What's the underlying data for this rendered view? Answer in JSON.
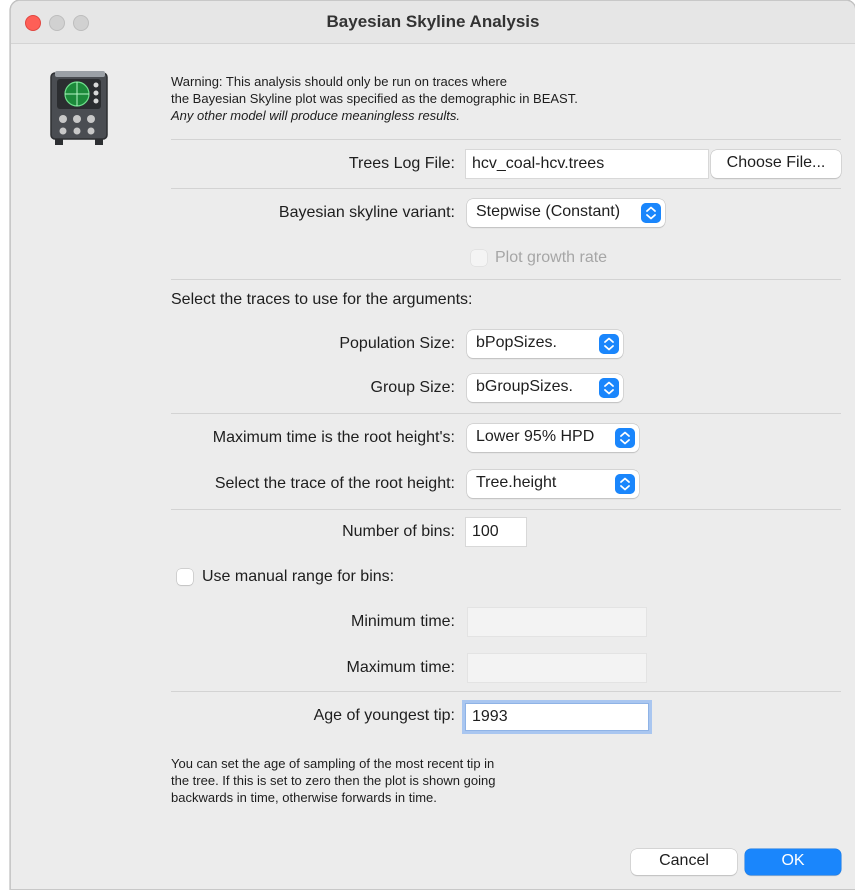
{
  "window": {
    "title": "Bayesian Skyline Analysis"
  },
  "warning": {
    "line1": "Warning: This analysis should only be run on traces where",
    "line2": "the Bayesian Skyline plot was specified as the demographic in BEAST.",
    "line3": "Any other model will produce meaningless results."
  },
  "trees_log": {
    "label": "Trees Log File:",
    "value": "hcv_coal-hcv.trees",
    "choose_button": "Choose File..."
  },
  "variant": {
    "label": "Bayesian skyline variant:",
    "value": "Stepwise (Constant)"
  },
  "growth_rate": {
    "label": "Plot growth rate",
    "checked": false,
    "enabled": false
  },
  "traces_heading": "Select the traces to use for the arguments:",
  "population_size": {
    "label": "Population Size:",
    "value": "bPopSizes."
  },
  "group_size": {
    "label": "Group Size:",
    "value": "bGroupSizes."
  },
  "max_time": {
    "label": "Maximum time is the root height's:",
    "value": "Lower 95% HPD"
  },
  "root_height": {
    "label": "Select the trace of the root height:",
    "value": "Tree.height"
  },
  "bins": {
    "label": "Number of bins:",
    "value": "100"
  },
  "manual_range": {
    "label": "Use manual range for bins:",
    "checked": false
  },
  "min_time": {
    "label": "Minimum time:",
    "value": ""
  },
  "max_time_field": {
    "label": "Maximum time:",
    "value": ""
  },
  "youngest_tip": {
    "label": "Age of youngest tip:",
    "value": "1993"
  },
  "note": {
    "line1": "You can set the age of sampling of the most recent tip in",
    "line2": "the tree. If this is set to zero then the plot is shown going",
    "line3": "backwards in time, otherwise forwards in time."
  },
  "buttons": {
    "cancel": "Cancel",
    "ok": "OK"
  },
  "colors": {
    "accent": "#1a86fc",
    "close": "#fe5f57",
    "window_bg": "#ececec"
  }
}
